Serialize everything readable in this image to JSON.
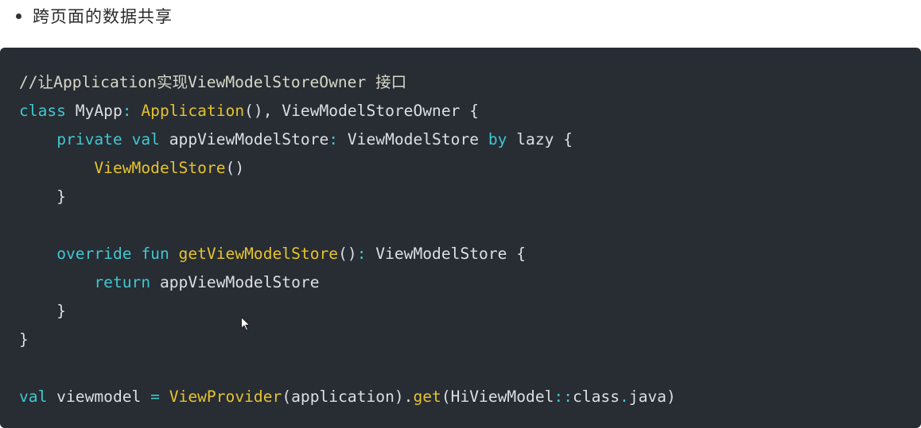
{
  "bullet": {
    "text": "跨页面的数据共享"
  },
  "code": {
    "lines": [
      [
        {
          "t": "//让Application实现ViewModelStoreOwner 接口",
          "c": "comment"
        }
      ],
      [
        {
          "t": "class",
          "c": "kw"
        },
        {
          "t": " MyApp",
          "c": "plain"
        },
        {
          "t": ":",
          "c": "kw"
        },
        {
          "t": " ",
          "c": "plain"
        },
        {
          "t": "Application",
          "c": "type"
        },
        {
          "t": "(), ViewModelStoreOwner {",
          "c": "plain"
        }
      ],
      [
        {
          "t": "    ",
          "c": "plain"
        },
        {
          "t": "private",
          "c": "kw"
        },
        {
          "t": " ",
          "c": "plain"
        },
        {
          "t": "val",
          "c": "kw"
        },
        {
          "t": " appViewModelStore",
          "c": "plain"
        },
        {
          "t": ":",
          "c": "kw"
        },
        {
          "t": " ViewModelStore ",
          "c": "plain"
        },
        {
          "t": "by",
          "c": "kw"
        },
        {
          "t": " lazy {",
          "c": "plain"
        }
      ],
      [
        {
          "t": "        ",
          "c": "plain"
        },
        {
          "t": "ViewModelStore",
          "c": "type"
        },
        {
          "t": "()",
          "c": "plain"
        }
      ],
      [
        {
          "t": "    }",
          "c": "plain"
        }
      ],
      [],
      [
        {
          "t": "    ",
          "c": "plain"
        },
        {
          "t": "override",
          "c": "kw"
        },
        {
          "t": " ",
          "c": "plain"
        },
        {
          "t": "fun",
          "c": "kw"
        },
        {
          "t": " ",
          "c": "plain"
        },
        {
          "t": "getViewModelStore",
          "c": "type"
        },
        {
          "t": "()",
          "c": "plain"
        },
        {
          "t": ":",
          "c": "kw"
        },
        {
          "t": " ViewModelStore {",
          "c": "plain"
        }
      ],
      [
        {
          "t": "        ",
          "c": "plain"
        },
        {
          "t": "return",
          "c": "kw"
        },
        {
          "t": " appViewModelStore",
          "c": "plain"
        }
      ],
      [
        {
          "t": "    }",
          "c": "plain"
        }
      ],
      [
        {
          "t": "}",
          "c": "plain"
        }
      ],
      [],
      [
        {
          "t": "val",
          "c": "kw"
        },
        {
          "t": " viewmodel ",
          "c": "plain"
        },
        {
          "t": "=",
          "c": "kw"
        },
        {
          "t": " ",
          "c": "plain"
        },
        {
          "t": "ViewProvider",
          "c": "type"
        },
        {
          "t": "(application).",
          "c": "plain"
        },
        {
          "t": "get",
          "c": "type"
        },
        {
          "t": "(HiViewModel",
          "c": "plain"
        },
        {
          "t": "::",
          "c": "kw"
        },
        {
          "t": "class",
          "c": "plain"
        },
        {
          "t": ".",
          "c": "kw"
        },
        {
          "t": "java)",
          "c": "plain"
        }
      ]
    ]
  },
  "icons": {
    "cursor": "mouse-pointer-icon"
  }
}
